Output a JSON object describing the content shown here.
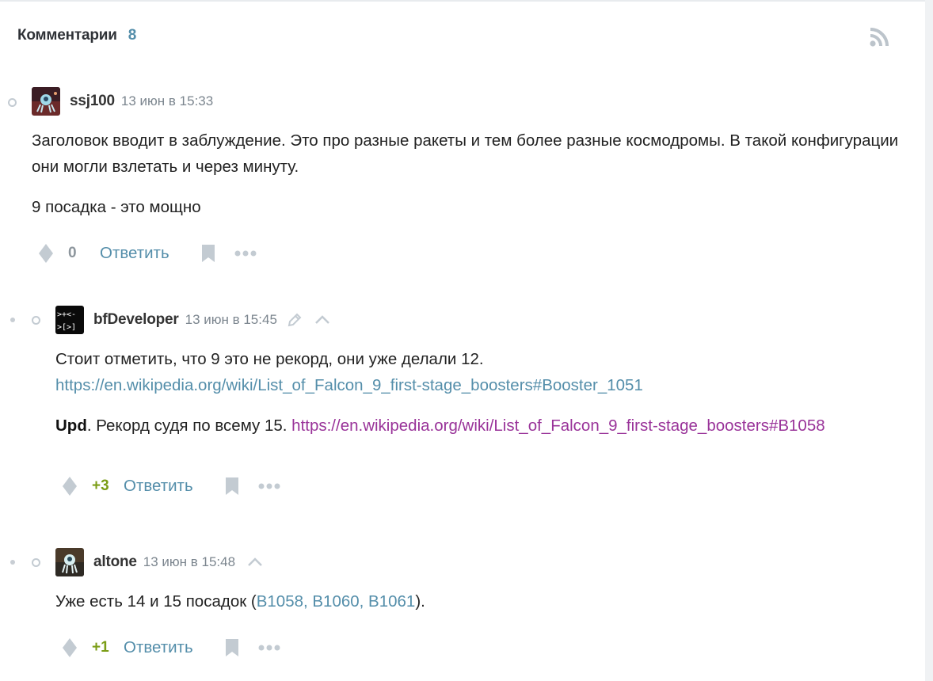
{
  "header": {
    "title": "Комментарии",
    "count": "8"
  },
  "comments": [
    {
      "username": "ssj100",
      "time": "13 июн в 15:33",
      "paragraphs": [
        "Заголовок вводит в заблуждение. Это про разные ракеты и тем более разные космодромы. В такой конфигурации они могли взлетать и через минуту.",
        "9 посадка - это мощно"
      ],
      "score": "0",
      "reply_label": "Ответить"
    },
    {
      "username": "bfDeveloper",
      "time": "13 июн в 15:45",
      "line1_text": "Стоит отметить, что 9 это не рекорд, они уже делали 12.",
      "line1_link": "https://en.wikipedia.org/wiki/List_of_Falcon_9_first-stage_boosters#Booster_1051",
      "upd_label": "Upd",
      "upd_text": ". Рекорд судя по всему 15. ",
      "upd_link": "https://en.wikipedia.org/wiki/List_of_Falcon_9_first-stage_boosters#B1058",
      "score": "+3",
      "reply_label": "Ответить"
    },
    {
      "username": "altone",
      "time": "13 июн в 15:48",
      "text_before": "Уже есть 14 и 15 посадок (",
      "links": "B1058, B1060, B1061",
      "text_after": ").",
      "score": "+1",
      "reply_label": "Ответить"
    }
  ],
  "icons": {
    "rss": "rss-icon",
    "vote": "vote-diamond-icon",
    "bookmark": "bookmark-icon",
    "more": "more-dots-icon",
    "edit": "pencil-icon",
    "parent": "chevron-up-icon"
  },
  "colors": {
    "link": "#548eaa",
    "visited_link": "#993399",
    "positive_score": "#7b9d16",
    "neutral_score": "#8d969d",
    "icon_gray": "#c3cbd2"
  }
}
